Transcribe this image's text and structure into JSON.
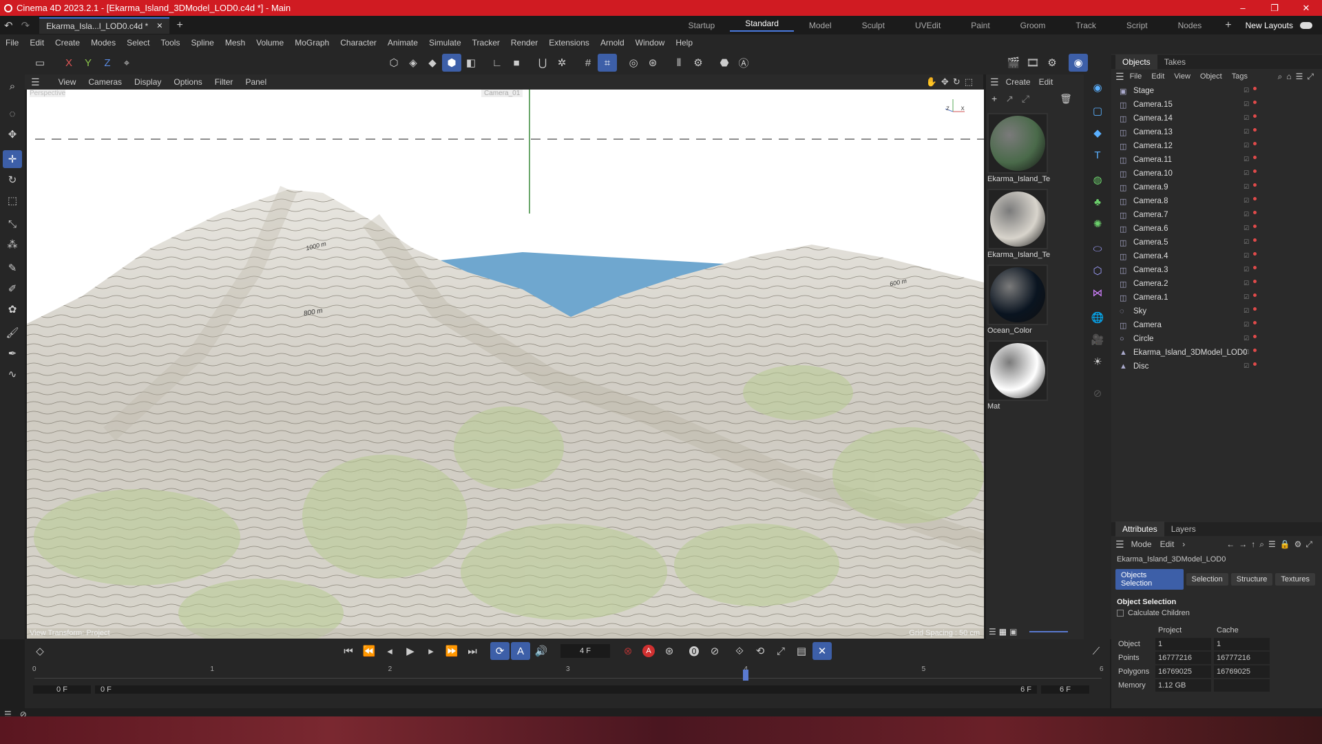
{
  "window": {
    "title": "Cinema 4D 2023.2.1 - [Ekarma_Island_3DModel_LOD0.c4d *] - Main"
  },
  "tabs": {
    "doc_tab": "Ekarma_Isla...l_LOD0.c4d *"
  },
  "layouts": [
    "Startup",
    "Standard",
    "Model",
    "Sculpt",
    "UVEdit",
    "Paint",
    "Groom",
    "Track",
    "Script",
    "Nodes"
  ],
  "layouts_active": "Standard",
  "new_layouts": "New Layouts",
  "menu": [
    "File",
    "Edit",
    "Create",
    "Modes",
    "Select",
    "Tools",
    "Spline",
    "Mesh",
    "Volume",
    "MoGraph",
    "Character",
    "Animate",
    "Simulate",
    "Tracker",
    "Render",
    "Extensions",
    "Arnold",
    "Window",
    "Help"
  ],
  "axis_labels": {
    "x": "X",
    "y": "Y",
    "z": "Z"
  },
  "viewport_menu": [
    "View",
    "Cameras",
    "Display",
    "Options",
    "Filter",
    "Panel"
  ],
  "viewport": {
    "corner_label": "Perspective",
    "top_label": "Camera_01",
    "contours": [
      "1000 m",
      "800 m",
      "600 m"
    ],
    "bottom_left": "View Transform: Project",
    "bottom_right": "Grid Spacing : 50 cm"
  },
  "material_panel": {
    "menu": [
      "Create",
      "Edit"
    ],
    "materials": [
      {
        "name": "Ekarma_Island_Te",
        "color": "#4a6a4a"
      },
      {
        "name": "Ekarma_Island_Te",
        "color": "#d8d4cc"
      },
      {
        "name": "Ocean_Color",
        "color": "#0a1420"
      },
      {
        "name": "Mat",
        "color": "#ffffff"
      }
    ]
  },
  "objects_panel": {
    "tabs": [
      "Objects",
      "Takes"
    ],
    "menu": [
      "File",
      "Edit",
      "View",
      "Object",
      "Tags"
    ],
    "items": [
      {
        "name": "Stage",
        "icon": "stage-icon"
      },
      {
        "name": "Camera.15",
        "icon": "camera-icon"
      },
      {
        "name": "Camera.14",
        "icon": "camera-icon"
      },
      {
        "name": "Camera.13",
        "icon": "camera-icon"
      },
      {
        "name": "Camera.12",
        "icon": "camera-icon"
      },
      {
        "name": "Camera.11",
        "icon": "camera-icon"
      },
      {
        "name": "Camera.10",
        "icon": "camera-icon"
      },
      {
        "name": "Camera.9",
        "icon": "camera-icon"
      },
      {
        "name": "Camera.8",
        "icon": "camera-icon"
      },
      {
        "name": "Camera.7",
        "icon": "camera-icon"
      },
      {
        "name": "Camera.6",
        "icon": "camera-icon"
      },
      {
        "name": "Camera.5",
        "icon": "camera-icon"
      },
      {
        "name": "Camera.4",
        "icon": "camera-icon"
      },
      {
        "name": "Camera.3",
        "icon": "camera-icon"
      },
      {
        "name": "Camera.2",
        "icon": "camera-icon"
      },
      {
        "name": "Camera.1",
        "icon": "camera-icon"
      },
      {
        "name": "Sky",
        "icon": "sky-icon"
      },
      {
        "name": "Camera",
        "icon": "camera-icon"
      },
      {
        "name": "Circle",
        "icon": "circle-icon"
      },
      {
        "name": "Ekarma_Island_3DModel_LOD0",
        "icon": "mesh-icon"
      },
      {
        "name": "Disc",
        "icon": "mesh-icon"
      }
    ]
  },
  "attributes_panel": {
    "tabs": [
      "Attributes",
      "Layers"
    ],
    "menu": [
      "Mode",
      "Edit"
    ],
    "object_name": "Ekarma_Island_3DModel_LOD0",
    "buttons": [
      "Objects Selection",
      "Selection",
      "Structure",
      "Textures"
    ],
    "section": "Object Selection",
    "checkbox": "Calculate Children",
    "col_project": "Project",
    "col_cache": "Cache",
    "rows": [
      {
        "label": "Object",
        "project": "1",
        "cache": "1"
      },
      {
        "label": "Points",
        "project": "16777216",
        "cache": "16777216"
      },
      {
        "label": "Polygons",
        "project": "16769025",
        "cache": "16769025"
      },
      {
        "label": "Memory",
        "project": "1.12 GB",
        "cache": ""
      }
    ]
  },
  "timeline": {
    "current_frame": "4 F",
    "ruler": [
      "0",
      "1",
      "2",
      "3",
      "4",
      "5",
      "6"
    ],
    "start_a": "0 F",
    "start_b": "0 F",
    "end_a": "6 F",
    "end_b": "6 F",
    "playhead_frame": 4,
    "max_frame": 6
  },
  "colors": {
    "accent": "#3d5fa8",
    "titlebar": "#d01b22",
    "ocean": "#6fa7cf"
  }
}
